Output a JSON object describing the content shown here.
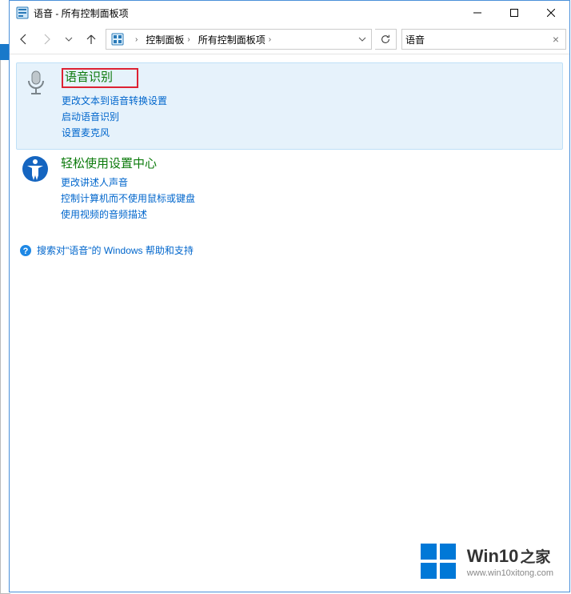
{
  "window": {
    "title": "语音 - 所有控制面板项"
  },
  "breadcrumb": {
    "items": [
      "控制面板",
      "所有控制面板项"
    ]
  },
  "search": {
    "value": "语音",
    "clear_glyph": "×"
  },
  "results": [
    {
      "title": "语音识别",
      "tasks": [
        "更改文本到语音转换设置",
        "启动语音识别",
        "设置麦克风"
      ],
      "highlighted": true,
      "boxed_title": true,
      "icon": "microphone"
    },
    {
      "title": "轻松使用设置中心",
      "tasks": [
        "更改讲述人声音",
        "控制计算机而不使用鼠标或键盘",
        "使用视频的音频描述"
      ],
      "highlighted": false,
      "boxed_title": false,
      "icon": "ease-of-access"
    }
  ],
  "help_link": "搜索对\"语音\"的 Windows 帮助和支持",
  "watermark": {
    "brand_en": "Win10",
    "brand_zh": "之家",
    "url": "www.win10xitong.com"
  }
}
